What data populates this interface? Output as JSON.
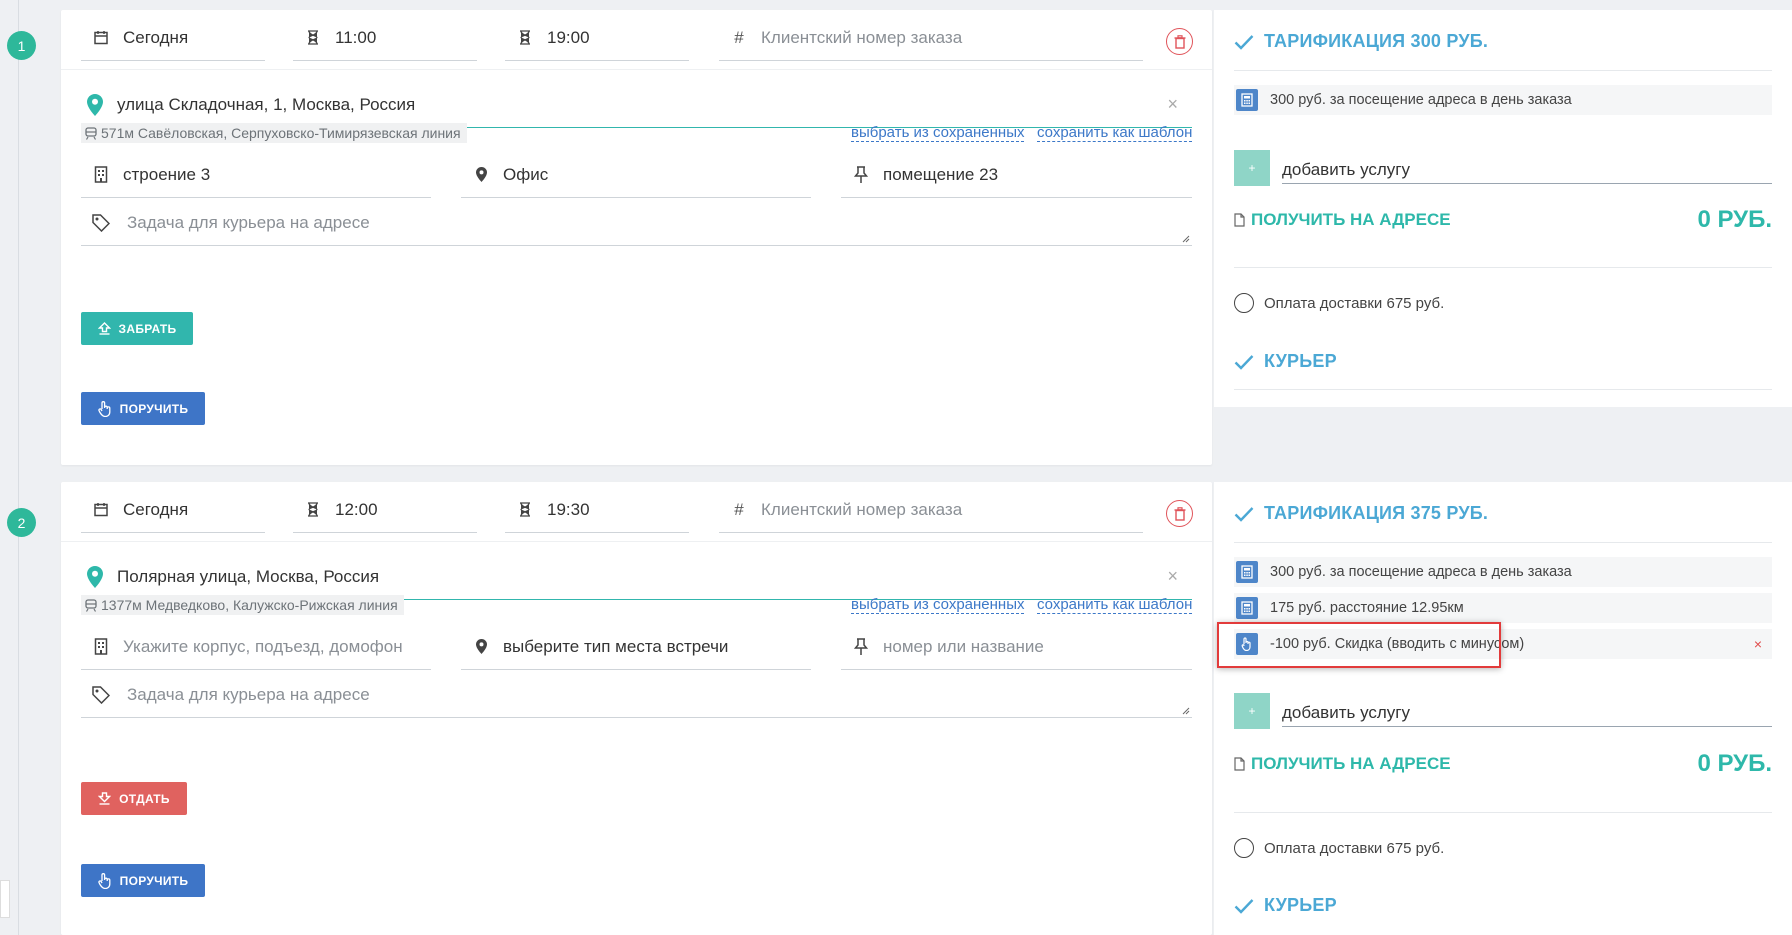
{
  "orders": [
    {
      "step": "1",
      "date": "Сегодня",
      "time_from": "11:00",
      "time_to": "19:00",
      "order_number_placeholder": "Клиентский номер заказа",
      "address": "улица Складочная, 1, Москва, Россия",
      "metro": "571м Савёловская, Серпуховско-Тимирязевская линия",
      "pick_saved_link": "выбрать из сохраненных",
      "save_template_link": "сохранить как шаблон",
      "building": "строение 3",
      "meeting_place": "Офис",
      "room": "помещение 23",
      "task_placeholder": "Задача для курьера на адресе",
      "action_button": "ЗАБРАТЬ",
      "assign_button": "ПОРУЧИТЬ"
    },
    {
      "step": "2",
      "date": "Сегодня",
      "time_from": "12:00",
      "time_to": "19:30",
      "order_number_placeholder": "Клиентский номер заказа",
      "address": "Полярная улица, Москва, Россия",
      "metro": "1377м Медведково, Калужско-Рижская линия",
      "pick_saved_link": "выбрать из сохраненных",
      "save_template_link": "сохранить как шаблон",
      "building_placeholder": "Укажите корпус, подъезд, домофон",
      "meeting_place": "выберите тип места встречи",
      "room_placeholder": "номер или название",
      "task_placeholder": "Задача для курьера на адресе",
      "action_button": "ОТДАТЬ",
      "assign_button": "ПОРУЧИТЬ"
    }
  ],
  "tariffs": [
    {
      "title": "ТАРИФИКАЦИЯ 300 РУБ.",
      "services": [
        "300 руб. за посещение адреса в день заказа"
      ],
      "add_service": "добавить услугу",
      "receive_label": "ПОЛУЧИТЬ НА АДРЕСЕ",
      "receive_sum": "0 РУБ.",
      "payment_option": "Оплата доставки 675 руб.",
      "courier": "КУРЬЕР"
    },
    {
      "title": "ТАРИФИКАЦИЯ 375 РУБ.",
      "services": [
        "300 руб. за посещение адреса в день заказа",
        "175 руб. расстояние 12.95км",
        "-100 руб. Скидка (вводить с минусом)"
      ],
      "add_service": "добавить услугу",
      "receive_label": "ПОЛУЧИТЬ НА АДРЕСЕ",
      "receive_sum": "0 РУБ.",
      "payment_option": "Оплата доставки 675 руб.",
      "courier": "КУРЬЕР"
    }
  ],
  "colors": {
    "accent_teal": "#31b6ad",
    "accent_blue": "#3e75c7",
    "accent_red": "#e0625f",
    "header_blue": "#4ba8d5",
    "highlight": "#e23b3b"
  }
}
